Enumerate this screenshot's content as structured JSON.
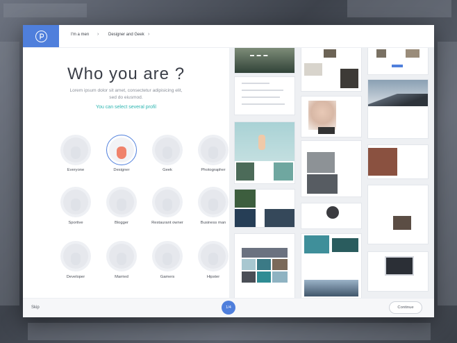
{
  "breadcrumb": [
    "I'm a men",
    "Designer and Geek"
  ],
  "title": "Who you are ?",
  "subtitle_lines": [
    "Lorem ipsum dolor sit amet, consectetur adipisicing elit,",
    "sed do eiusmod."
  ],
  "hint": "You can select several profil",
  "profiles": [
    {
      "label": "Everyone",
      "selected": false
    },
    {
      "label": "Designer",
      "selected": true
    },
    {
      "label": "Geek",
      "selected": false
    },
    {
      "label": "Photographer",
      "selected": false
    },
    {
      "label": "Sportive",
      "selected": false
    },
    {
      "label": "Blogger",
      "selected": false
    },
    {
      "label": "Restaurant owner",
      "selected": false
    },
    {
      "label": "Business man",
      "selected": false
    },
    {
      "label": "Developer",
      "selected": false
    },
    {
      "label": "Married",
      "selected": false
    },
    {
      "label": "Gamers",
      "selected": false
    },
    {
      "label": "Hipster",
      "selected": false
    }
  ],
  "footer": {
    "skip": "Skip",
    "pager": "1/4",
    "continue": "Continue"
  },
  "colors": {
    "accent": "#4f7fdc",
    "teal": "#2cb5b0",
    "selected_face": "#f0826b"
  },
  "icons": {
    "logo": "pinterest-like-logo-icon",
    "separator": "chevron-right-icon"
  }
}
